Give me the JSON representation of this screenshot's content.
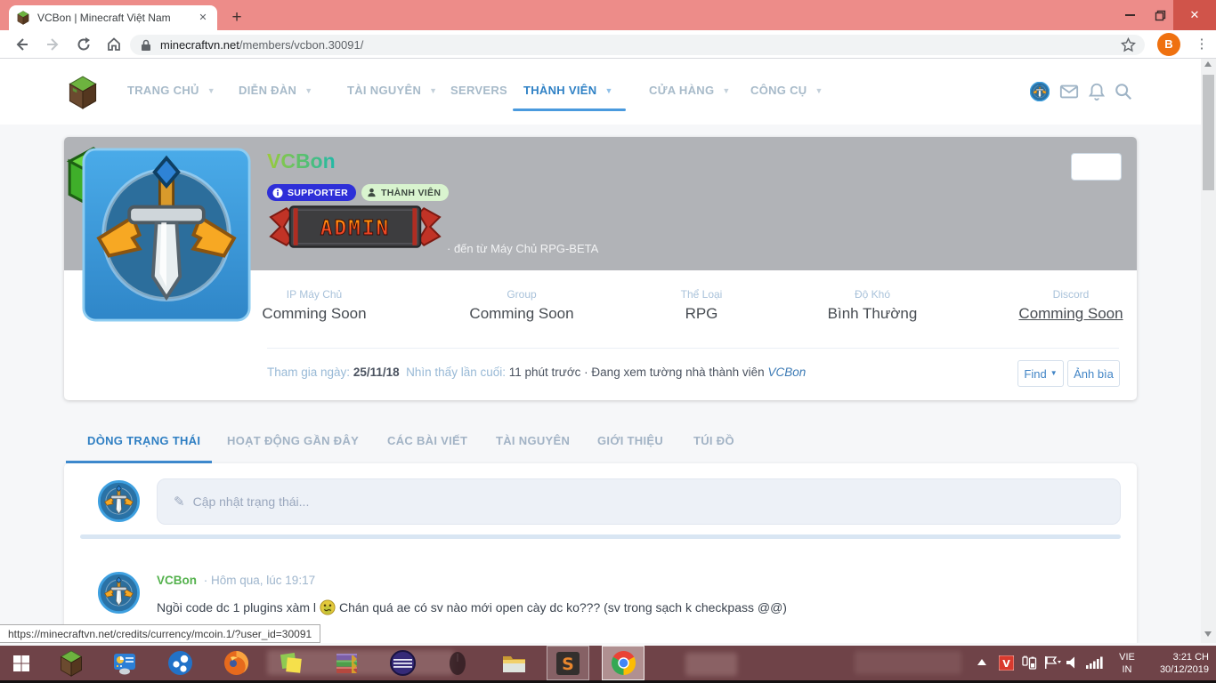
{
  "window": {
    "tab_title": "VCBon | Minecraft Việt Nam",
    "new_tab_label": "+"
  },
  "browser": {
    "url_domain": "minecraftvn.net",
    "url_path": "/members/vcbon.30091/",
    "profile_initial": "B"
  },
  "site_nav": {
    "items": [
      {
        "label": "TRANG CHỦ",
        "caret": true
      },
      {
        "label": "DIỄN ĐÀN",
        "caret": true
      },
      {
        "label": "TÀI NGUYÊN",
        "caret": true
      },
      {
        "label": "SERVERS",
        "caret": false
      },
      {
        "label": "THÀNH VIÊN",
        "caret": true,
        "active": true
      },
      {
        "label": "CỬA HÀNG",
        "caret": true
      },
      {
        "label": "CÔNG CỤ",
        "caret": true
      }
    ]
  },
  "profile": {
    "username": "VCBon",
    "badges": [
      {
        "label": "SUPPORTER",
        "color": "#2e2fd8"
      },
      {
        "label": "THÀNH VIÊN",
        "color": "#d9f4cf"
      }
    ],
    "admin_text": "ADMIN",
    "origin": "· đến từ Máy Chủ RPG-BETA",
    "stats": [
      {
        "label": "IP Máy Chủ",
        "value": "Comming Soon"
      },
      {
        "label": "Group",
        "value": "Comming Soon"
      },
      {
        "label": "Thể Loại",
        "value": "RPG"
      },
      {
        "label": "Độ Khó",
        "value": "Bình Thường"
      },
      {
        "label": "Discord",
        "value": "Comming Soon",
        "underlined": true
      }
    ],
    "joined_label": "Tham gia ngày:",
    "joined_value": "25/11/18",
    "last_seen_label": "Nhìn thấy lần cuối:",
    "last_seen_value": "11 phút trước · Đang xem tường nhà thành viên",
    "last_seen_link": "VCBon",
    "find_button": "Find",
    "cover_button": "Ảnh bìa"
  },
  "profile_tabs": {
    "items": [
      "DÒNG TRẠNG THÁI",
      "HOẠT ĐỘNG GẦN ĐÂY",
      "CÁC BÀI VIẾT",
      "TÀI NGUYÊN",
      "GIỚI THIỆU",
      "TÚI ĐỒ"
    ]
  },
  "composer": {
    "placeholder": "Cập nhật trạng thái..."
  },
  "post": {
    "author": "VCBon",
    "timestamp": "· Hôm qua, lúc 19:17",
    "message_before": "Ngồi code dc 1 plugins xàm l",
    "emoji": "sick-face",
    "message_after": "Chán quá ae có sv nào mới open cày dc ko??? (sv trong sạch k checkpass @@)"
  },
  "status_bar": {
    "link_url": "https://minecraftvn.net/credits/currency/mcoin.1/?user_id=30091"
  },
  "taskbar": {
    "apps": [
      "start",
      "minecraft",
      "settings-app",
      "dots-app",
      "firefox",
      "sticky-notes",
      "winrar",
      "eclipse",
      "mouse-tool",
      "file-explorer",
      "sublime-text",
      "chrome"
    ],
    "tray": {
      "lang_top": "VIE",
      "lang_bottom": "IN",
      "time": "3:21 CH",
      "date": "30/12/2019"
    }
  },
  "theme": {
    "titlebar": "#ed8c89",
    "close_button": "#d0544a",
    "accent_blue": "#3e8bd0",
    "banner_gray": "#b1b3b7",
    "supporter_badge": "#2e2fd8",
    "member_badge": "#d9f4cf",
    "author_green": "#55b24e",
    "taskbar": "#6f4348"
  }
}
